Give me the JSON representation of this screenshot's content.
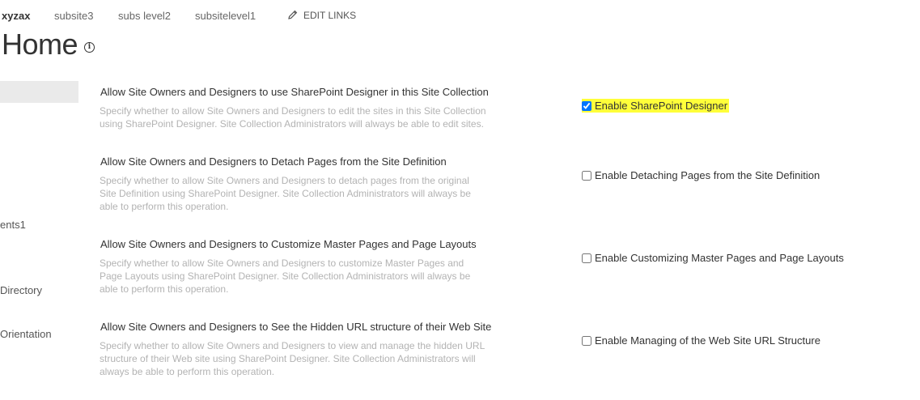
{
  "topnav": {
    "items": [
      "xyzax",
      "subsite3",
      "subs level2",
      "subsitelevel1"
    ],
    "edit_links": "EDIT LINKS"
  },
  "page": {
    "title": "Home",
    "info_icon_glyph": "i"
  },
  "leftnav": {
    "items": [
      "ents1",
      "Directory",
      "Orientation"
    ]
  },
  "sections": [
    {
      "title": "Allow Site Owners and Designers to use SharePoint Designer in this Site Collection",
      "description": "Specify whether to allow Site Owners and Designers to edit the sites in this Site Collection using SharePoint Designer. Site Collection Administrators will always be able to edit sites.",
      "option_label": "Enable SharePoint Designer",
      "checked": true
    },
    {
      "title": "Allow Site Owners and Designers to Detach Pages from the Site Definition",
      "description": "Specify whether to allow Site Owners and Designers to detach pages from the original Site Definition using SharePoint Designer. Site Collection Administrators will always be able to perform this operation.",
      "option_label": "Enable Detaching Pages from the Site Definition",
      "checked": false
    },
    {
      "title": "Allow Site Owners and Designers to Customize Master Pages and Page Layouts",
      "description": "Specify whether to allow Site Owners and Designers to customize Master Pages and Page Layouts using SharePoint Designer. Site Collection Administrators will always be able to perform this operation.",
      "option_label": "Enable Customizing Master Pages and Page Layouts",
      "checked": false
    },
    {
      "title": "Allow Site Owners and Designers to See the Hidden URL structure of their Web Site",
      "description": "Specify whether to allow Site Owners and Designers to view and manage the hidden URL structure of their Web site using SharePoint Designer. Site Collection Administrators will always be able to perform this operation.",
      "option_label": "Enable Managing of the Web Site URL Structure",
      "checked": false
    }
  ],
  "colors": {
    "highlight": "#ffff3a",
    "text": "#333333",
    "muted": "#b3b3b3"
  }
}
